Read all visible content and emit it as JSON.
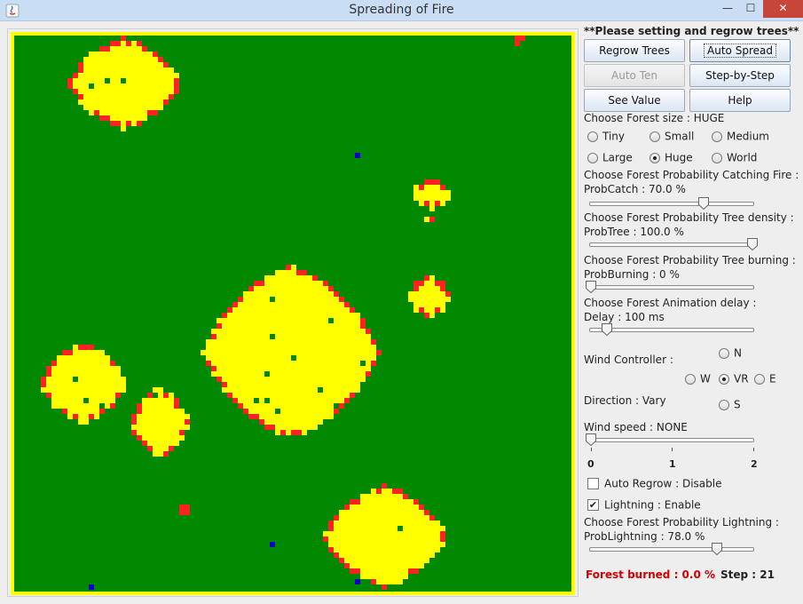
{
  "window": {
    "title": "Spreading of Fire",
    "min": "—",
    "max": "☐",
    "close": "✕"
  },
  "forest": {
    "colors": {
      "tree": "#008800",
      "fire": "#ffff00",
      "burning_edge": "#ff2222",
      "empty": "#0000cc",
      "border": "#ffff00"
    },
    "grid_cols": 106,
    "grid_rows": 106
  },
  "panel": {
    "hint": "**Please setting and regrow trees**",
    "buttons": {
      "regrow": "Regrow Trees",
      "auto_spread": "Auto Spread",
      "auto_ten": "Auto Ten",
      "step": "Step-by-Step",
      "see_value": "See Value",
      "help": "Help"
    },
    "size": {
      "label": "Choose Forest size : HUGE",
      "options": [
        "Tiny",
        "Small",
        "Medium",
        "Large",
        "Huge",
        "World"
      ],
      "selected": "Huge"
    },
    "prob_catch": {
      "label": "Choose Forest Probability Catching Fire :",
      "value_text": "ProbCatch : 70.0 %",
      "fraction": 0.7
    },
    "prob_tree": {
      "label": "Choose Forest Probability Tree density :",
      "value_text": "ProbTree : 100.0 %",
      "fraction": 1.0
    },
    "prob_burning": {
      "label": "Choose Forest Probability Tree burning :",
      "value_text": "ProbBurning : 0 %",
      "fraction": 0.0
    },
    "delay": {
      "label": "Choose Forest Animation delay :",
      "value_text": "Delay : 100 ms",
      "fraction": 0.1
    },
    "wind": {
      "label": "Wind Controller :",
      "n": "N",
      "w": "W",
      "vr": "VR",
      "e": "E",
      "s": "S",
      "selected": "VR",
      "direction": "Direction : Vary",
      "speed_label": "Wind speed : NONE",
      "speed_fraction": 0.0,
      "ticks": [
        "0",
        "1",
        "2"
      ]
    },
    "auto_regrow": {
      "label": "Auto Regrow : Disable",
      "checked": false
    },
    "lightning": {
      "label": "Lightning : Enable",
      "checked": true,
      "check_glyph": "✔"
    },
    "prob_lightning": {
      "label": "Choose Forest Probability Lightning :",
      "value_text": "ProbLightning : 78.0 %",
      "fraction": 0.78
    },
    "status": {
      "burned": "Forest burned : 0.0 %",
      "step": "Step : 21"
    }
  }
}
